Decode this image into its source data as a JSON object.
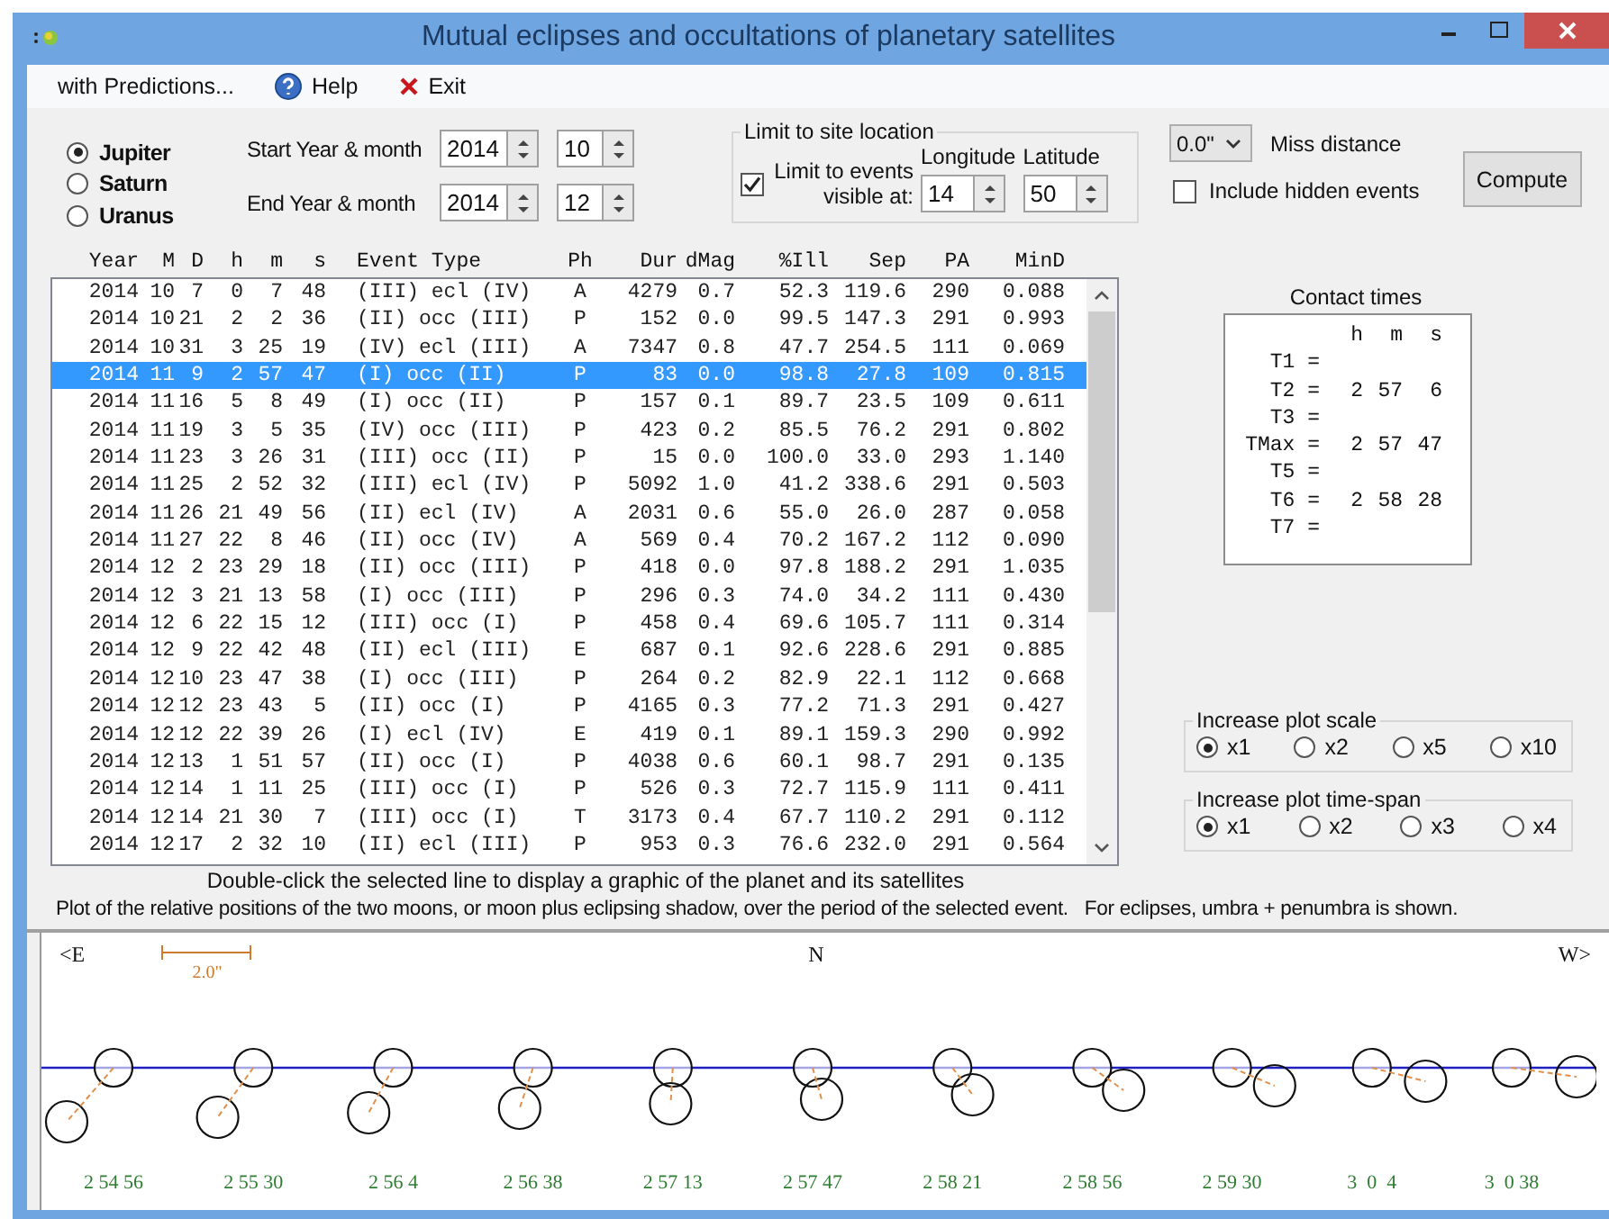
{
  "window": {
    "title": "Mutual eclipses and occultations of planetary satellites"
  },
  "menu": [
    {
      "label": "with Predictions...",
      "kind": "text"
    },
    {
      "label": "Help",
      "kind": "help"
    },
    {
      "label": "Exit",
      "kind": "exit"
    }
  ],
  "planets": [
    {
      "label": "Jupiter",
      "selected": true
    },
    {
      "label": "Saturn",
      "selected": false
    },
    {
      "label": "Uranus",
      "selected": false
    }
  ],
  "date_range": [
    {
      "label": "Start Year & month",
      "year": "2014",
      "month": "10"
    },
    {
      "label": "End Year & month",
      "year": "2014",
      "month": "12"
    }
  ],
  "site_limit": {
    "title": "Limit to site location",
    "checkbox_label": "Limit to events visible at:",
    "checked": true,
    "longitude_label": "Longitude",
    "latitude_label": "Latitude",
    "longitude": "14",
    "latitude": "50"
  },
  "miss_distance": {
    "value": "0.0\"",
    "label": "Miss distance"
  },
  "include_hidden": {
    "label": "Include hidden events",
    "checked": false
  },
  "compute_button": "Compute",
  "table": {
    "columns": [
      "Year",
      "M",
      "D",
      "h",
      "m",
      "s",
      "Event Type",
      "Ph",
      "Dur",
      "dMag",
      "%Ill",
      "Sep",
      "PA",
      "MinD"
    ],
    "rows": [
      {
        "cells": [
          "2014",
          "10",
          "7",
          "0",
          "7",
          "48",
          "(III) ecl (IV)",
          "A",
          "4279",
          "0.7",
          "52.3",
          "119.6",
          "290",
          "0.088"
        ],
        "selected": false
      },
      {
        "cells": [
          "2014",
          "10",
          "21",
          "2",
          "2",
          "36",
          "(II) occ (III)",
          "P",
          "152",
          "0.0",
          "99.5",
          "147.3",
          "291",
          "0.993"
        ],
        "selected": false
      },
      {
        "cells": [
          "2014",
          "10",
          "31",
          "3",
          "25",
          "19",
          "(IV) ecl (III)",
          "A",
          "7347",
          "0.8",
          "47.7",
          "254.5",
          "111",
          "0.069"
        ],
        "selected": false
      },
      {
        "cells": [
          "2014",
          "11",
          "9",
          "2",
          "57",
          "47",
          "(I) occ (II)",
          "P",
          "83",
          "0.0",
          "98.8",
          "27.8",
          "109",
          "0.815"
        ],
        "selected": true
      },
      {
        "cells": [
          "2014",
          "11",
          "16",
          "5",
          "8",
          "49",
          "(I) occ (II)",
          "P",
          "157",
          "0.1",
          "89.7",
          "23.5",
          "109",
          "0.611"
        ],
        "selected": false
      },
      {
        "cells": [
          "2014",
          "11",
          "19",
          "3",
          "5",
          "35",
          "(IV) occ (III)",
          "P",
          "423",
          "0.2",
          "85.5",
          "76.2",
          "291",
          "0.802"
        ],
        "selected": false
      },
      {
        "cells": [
          "2014",
          "11",
          "23",
          "3",
          "26",
          "31",
          "(III) occ (II)",
          "P",
          "15",
          "0.0",
          "100.0",
          "33.0",
          "293",
          "1.140"
        ],
        "selected": false
      },
      {
        "cells": [
          "2014",
          "11",
          "25",
          "2",
          "52",
          "32",
          "(III) ecl (IV)",
          "P",
          "5092",
          "1.0",
          "41.2",
          "338.6",
          "291",
          "0.503"
        ],
        "selected": false
      },
      {
        "cells": [
          "2014",
          "11",
          "26",
          "21",
          "49",
          "56",
          "(II) ecl (IV)",
          "A",
          "2031",
          "0.6",
          "55.0",
          "26.0",
          "287",
          "0.058"
        ],
        "selected": false
      },
      {
        "cells": [
          "2014",
          "11",
          "27",
          "22",
          "8",
          "46",
          "(II) occ (IV)",
          "A",
          "569",
          "0.4",
          "70.2",
          "167.2",
          "112",
          "0.090"
        ],
        "selected": false
      },
      {
        "cells": [
          "2014",
          "12",
          "2",
          "23",
          "29",
          "18",
          "(II) occ (III)",
          "P",
          "418",
          "0.0",
          "97.8",
          "188.2",
          "291",
          "1.035"
        ],
        "selected": false
      },
      {
        "cells": [
          "2014",
          "12",
          "3",
          "21",
          "13",
          "58",
          "(I) occ (III)",
          "P",
          "296",
          "0.3",
          "74.0",
          "34.2",
          "111",
          "0.430"
        ],
        "selected": false
      },
      {
        "cells": [
          "2014",
          "12",
          "6",
          "22",
          "15",
          "12",
          "(III) occ (I)",
          "P",
          "458",
          "0.4",
          "69.6",
          "105.7",
          "111",
          "0.314"
        ],
        "selected": false
      },
      {
        "cells": [
          "2014",
          "12",
          "9",
          "22",
          "42",
          "48",
          "(II) ecl (III)",
          "E",
          "687",
          "0.1",
          "92.6",
          "228.6",
          "291",
          "0.885"
        ],
        "selected": false
      },
      {
        "cells": [
          "2014",
          "12",
          "10",
          "23",
          "47",
          "38",
          "(I) occ (III)",
          "P",
          "264",
          "0.2",
          "82.9",
          "22.1",
          "112",
          "0.668"
        ],
        "selected": false
      },
      {
        "cells": [
          "2014",
          "12",
          "12",
          "23",
          "43",
          "5",
          "(II) occ (I)",
          "P",
          "4165",
          "0.3",
          "77.2",
          "71.3",
          "291",
          "0.427"
        ],
        "selected": false
      },
      {
        "cells": [
          "2014",
          "12",
          "12",
          "22",
          "39",
          "26",
          "(I) ecl (IV)",
          "E",
          "419",
          "0.1",
          "89.1",
          "159.3",
          "290",
          "0.992"
        ],
        "selected": false
      },
      {
        "cells": [
          "2014",
          "12",
          "13",
          "1",
          "51",
          "57",
          "(II) occ (I)",
          "P",
          "4038",
          "0.6",
          "60.1",
          "98.7",
          "291",
          "0.135"
        ],
        "selected": false
      },
      {
        "cells": [
          "2014",
          "12",
          "14",
          "1",
          "11",
          "25",
          "(III) occ (I)",
          "P",
          "526",
          "0.3",
          "72.7",
          "115.9",
          "111",
          "0.411"
        ],
        "selected": false
      },
      {
        "cells": [
          "2014",
          "12",
          "14",
          "21",
          "30",
          "7",
          "(III) occ (I)",
          "T",
          "3173",
          "0.4",
          "67.7",
          "110.2",
          "291",
          "0.112"
        ],
        "selected": false
      },
      {
        "cells": [
          "2014",
          "12",
          "17",
          "2",
          "32",
          "10",
          "(II) ecl (III)",
          "P",
          "953",
          "0.3",
          "76.6",
          "232.0",
          "291",
          "0.564"
        ],
        "selected": false
      }
    ]
  },
  "contact_times": {
    "title": "Contact times",
    "header": [
      "h",
      "m",
      "s"
    ],
    "rows": [
      {
        "label": "T1 ="
      },
      {
        "label": "T2 =",
        "time": [
          "2",
          "57",
          "6"
        ]
      },
      {
        "label": "T3 ="
      },
      {
        "label": "TMax =",
        "time": [
          "2",
          "57",
          "47"
        ]
      },
      {
        "label": "T5 ="
      },
      {
        "label": "T6 =",
        "time": [
          "2",
          "58",
          "28"
        ]
      },
      {
        "label": "T7 ="
      }
    ]
  },
  "plot_scale": {
    "title": "Increase plot scale",
    "options": [
      {
        "label": "x1",
        "selected": true
      },
      {
        "label": "x2",
        "selected": false
      },
      {
        "label": "x5",
        "selected": false
      },
      {
        "label": "x10",
        "selected": false
      }
    ]
  },
  "plot_time_span": {
    "title": "Increase plot time-span",
    "options": [
      {
        "label": "x1",
        "selected": true
      },
      {
        "label": "x2",
        "selected": false
      },
      {
        "label": "x3",
        "selected": false
      },
      {
        "label": "x4",
        "selected": false
      }
    ]
  },
  "hint": "Double-click the selected line to display a graphic of the planet and its satellites",
  "plot": {
    "caption": "Plot of the relative positions of the two moons, or moon plus eclipsing shadow, over the period of the selected event.   For eclipses, umbra + penumbra is shown.",
    "east_label": "<E",
    "north_label": "N",
    "west_label": "W>",
    "scale_label": "2.0\"",
    "times": [
      "2 54 56",
      "2 55 30",
      "2 56 4",
      "2 56 38",
      "2 57 13",
      "2 57 47",
      "2 58 21",
      "2 58 56",
      "2 59 30",
      "3  0  4",
      "3  0 38"
    ]
  }
}
